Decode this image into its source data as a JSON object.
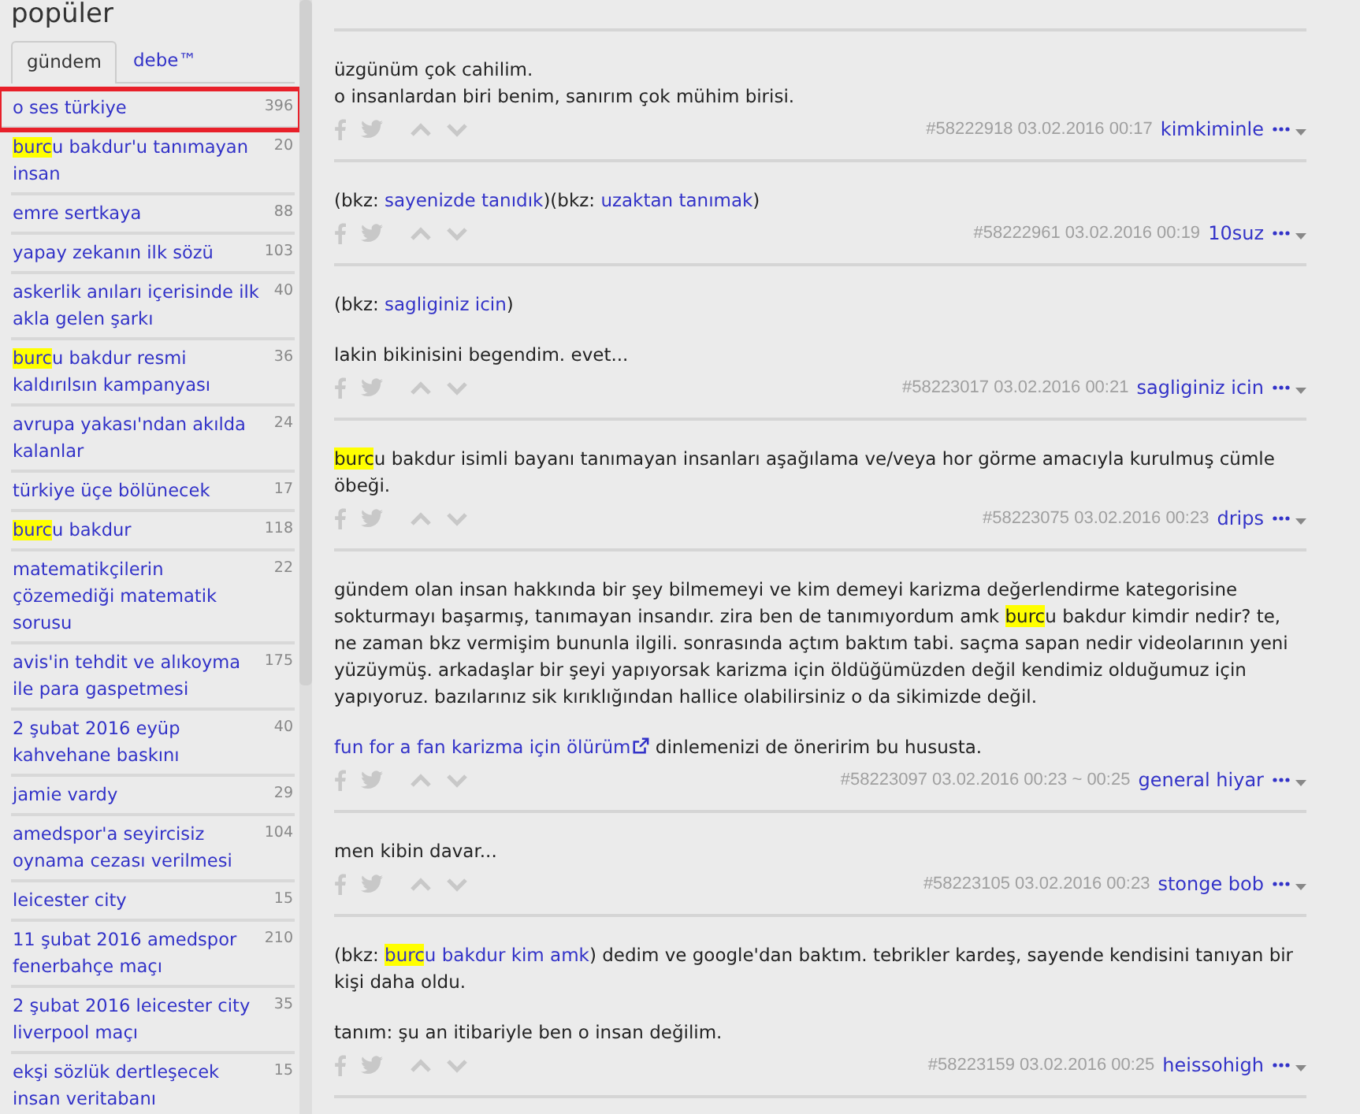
{
  "sidebar": {
    "title": "popüler",
    "tabs": [
      {
        "label": "gündem",
        "selected": true
      },
      {
        "label": "debe™",
        "selected": false
      }
    ],
    "items": [
      {
        "title": "o ses türkiye",
        "count": "396",
        "selected": true
      },
      {
        "highlight": "burc",
        "title": "u bakdur'u tanımayan insan",
        "count": "20",
        "selected": false
      },
      {
        "title": "emre sertkaya",
        "count": "88",
        "selected": false
      },
      {
        "title": "yapay zekanın ilk sözü",
        "count": "103",
        "selected": false
      },
      {
        "title": "askerlik anıları içerisinde ilk akla gelen şarkı",
        "count": "40",
        "selected": false
      },
      {
        "highlight": "burc",
        "title": "u bakdur resmi kaldırılsın kampanyası",
        "count": "36",
        "selected": false
      },
      {
        "title": "avrupa yakası'ndan akılda kalanlar",
        "count": "24",
        "selected": false
      },
      {
        "title": "türkiye üçe bölünecek",
        "count": "17",
        "selected": false
      },
      {
        "highlight": "burc",
        "title": "u bakdur",
        "count": "118",
        "selected": false
      },
      {
        "title": "matematikçilerin çözemediği matematik sorusu",
        "count": "22",
        "selected": false
      },
      {
        "title": "avis'in tehdit ve alıkoyma ile para gaspetmesi",
        "count": "175",
        "selected": false
      },
      {
        "title": "2 şubat 2016 eyüp kahvehane baskını",
        "count": "40",
        "selected": false
      },
      {
        "title": "jamie vardy",
        "count": "29",
        "selected": false
      },
      {
        "title": "amedspor'a seyircisiz oynama cezası verilmesi",
        "count": "104",
        "selected": false
      },
      {
        "title": "leicester city",
        "count": "15",
        "selected": false
      },
      {
        "title": "11 şubat 2016 amedspor fenerbahçe maçı",
        "count": "210",
        "selected": false
      },
      {
        "title": "2 şubat 2016 leicester city liverpool maçı",
        "count": "35",
        "selected": false
      },
      {
        "title": "ekşi sözlük dertleşecek insan veritabanı",
        "count": "15",
        "selected": false
      }
    ]
  },
  "entries": [
    {
      "blocks": [
        [
          [
            {
              "kind": "text",
              "text": "üzgünüm çok cahilim."
            }
          ],
          [
            {
              "kind": "text",
              "text": "o insanlardan biri benim, sanırım çok mühim birisi."
            }
          ]
        ]
      ],
      "meta": "#58222918 03.02.2016 00:17",
      "author": "kimkiminle"
    },
    {
      "blocks": [
        [
          [
            {
              "kind": "text",
              "text": "(bkz: "
            },
            {
              "kind": "link",
              "text": "sayenizde tanıdık"
            },
            {
              "kind": "text",
              "text": ")(bkz: "
            },
            {
              "kind": "link",
              "text": "uzaktan tanımak"
            },
            {
              "kind": "text",
              "text": ")"
            }
          ]
        ]
      ],
      "meta": "#58222961 03.02.2016 00:19",
      "author": "10suz"
    },
    {
      "blocks": [
        [
          [
            {
              "kind": "text",
              "text": "(bkz: "
            },
            {
              "kind": "link",
              "text": "sagliginiz icin"
            },
            {
              "kind": "text",
              "text": ")"
            }
          ]
        ],
        [
          [
            {
              "kind": "text",
              "text": "lakin bikinisini begendim. evet..."
            }
          ]
        ]
      ],
      "meta": "#58223017 03.02.2016 00:21",
      "author": "sagliginiz icin"
    },
    {
      "blocks": [
        [
          [
            {
              "kind": "mark",
              "text": "burc"
            },
            {
              "kind": "text",
              "text": "u bakdur isimli bayanı tanımayan insanları aşağılama ve/veya hor görme amacıyla kurulmuş cümle öbeği."
            }
          ]
        ]
      ],
      "meta": "#58223075 03.02.2016 00:23",
      "author": "drips"
    },
    {
      "blocks": [
        [
          [
            {
              "kind": "text",
              "text": "gündem olan insan hakkında bir şey bilmemeyi ve kim demeyi karizma değerlendirme kategorisine sokturmayı başarmış, tanımayan insandır. zira ben de tanımıyordum amk "
            },
            {
              "kind": "mark",
              "text": "burc"
            },
            {
              "kind": "text",
              "text": "u bakdur kimdir nedir? te, ne zaman bkz vermişim bununla ilgili. sonrasında açtım baktım tabi. saçma sapan nedir videolarının yeni yüzüymüş. arkadaşlar bir şeyi yapıyorsak karizma için öldüğümüzden değil kendimiz olduğumuz için yapıyoruz. bazılarınız sik kırıklığından hallice olabilirsiniz o da sikimizde değil."
            }
          ]
        ],
        [
          [
            {
              "kind": "external",
              "text": "fun for a fan karizma için ölürüm"
            },
            {
              "kind": "text",
              "text": " dinlemenizi de öneririm bu hususta."
            }
          ]
        ]
      ],
      "meta": "#58223097 03.02.2016 00:23 ~ 00:25",
      "author": "general hiyar"
    },
    {
      "blocks": [
        [
          [
            {
              "kind": "text",
              "text": "men kibin davar..."
            }
          ]
        ]
      ],
      "meta": "#58223105 03.02.2016 00:23",
      "author": "stonge bob"
    },
    {
      "blocks": [
        [
          [
            {
              "kind": "text",
              "text": "(bkz: "
            },
            {
              "kind": "mark-link",
              "text": "burc"
            },
            {
              "kind": "link",
              "text": "u bakdur kim amk"
            },
            {
              "kind": "text",
              "text": ") dedim ve google'dan baktım. tebrikler kardeş, sayende kendisini tanıyan bir kişi daha oldu."
            }
          ]
        ],
        [
          [
            {
              "kind": "text",
              "text": "tanım: şu an itibariyle ben o insan değilim."
            }
          ]
        ]
      ],
      "meta": "#58223159 03.02.2016 00:25",
      "author": "heissohigh"
    }
  ]
}
